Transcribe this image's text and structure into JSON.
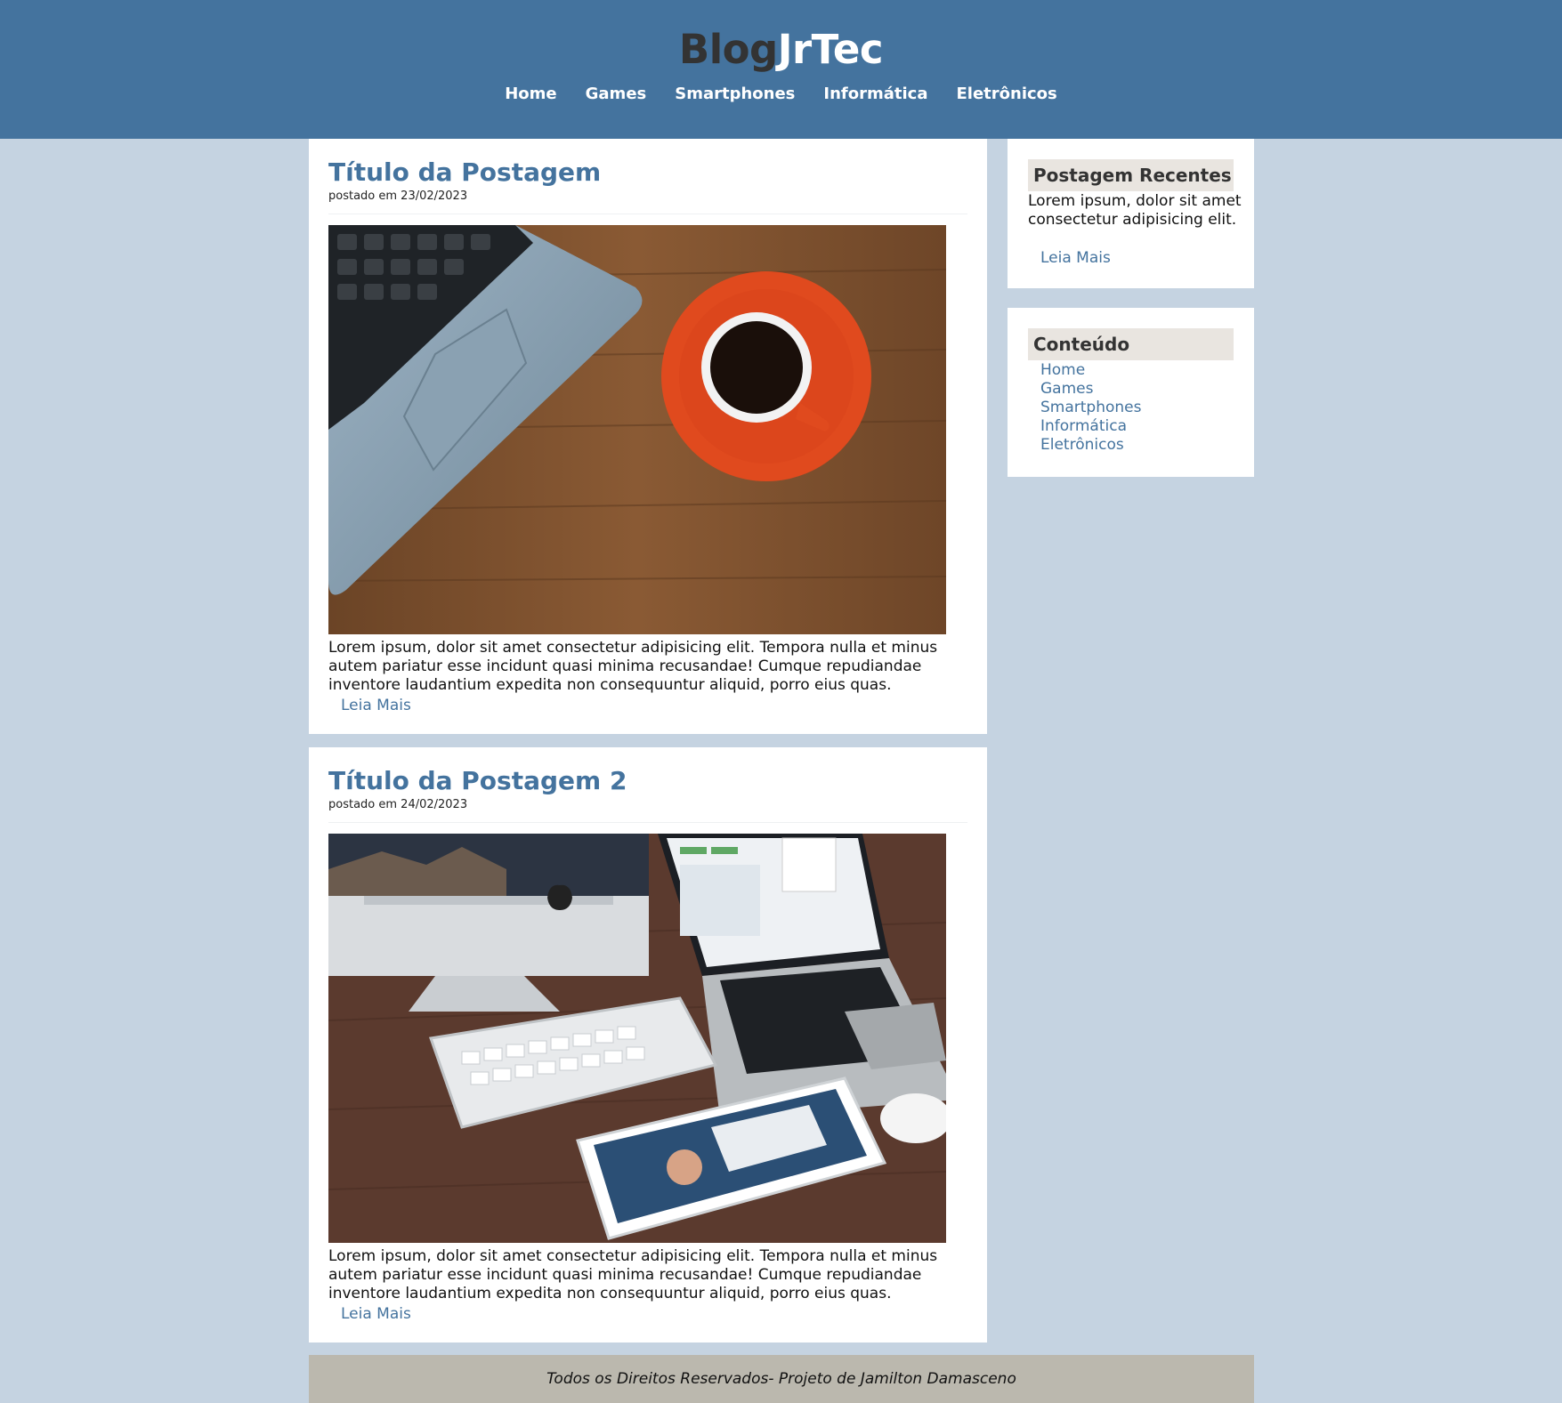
{
  "header": {
    "logo_part1": "Blog",
    "logo_part2": "JrTec",
    "nav": [
      "Home",
      "Games",
      "Smartphones",
      "Informática",
      "Eletrônicos"
    ]
  },
  "posts": [
    {
      "title": "Título da Postagem",
      "date": "postado em 23/02/2023",
      "body": "Lorem ipsum, dolor sit amet consectetur adipisicing elit. Tempora nulla et minus autem pariatur esse incidunt quasi minima recusandae! Cumque repudiandae inventore laudantium expedita non consequuntur aliquid, porro eius quas.",
      "read_more": "Leia Mais"
    },
    {
      "title": "Título da Postagem 2",
      "date": "postado em 24/02/2023",
      "body": "Lorem ipsum, dolor sit amet consectetur adipisicing elit. Tempora nulla et minus autem pariatur esse incidunt quasi minima recusandae! Cumque repudiandae inventore laudantium expedita non consequuntur aliquid, porro eius quas.",
      "read_more": "Leia Mais"
    }
  ],
  "sidebar": {
    "recent": {
      "title": "Postagem Recentes",
      "text": "Lorem ipsum, dolor sit amet consectetur adipisicing elit.",
      "link": "Leia Mais"
    },
    "content": {
      "title": "Conteúdo",
      "links": [
        "Home",
        "Games",
        "Smartphones",
        "Informática",
        "Eletrônicos"
      ]
    }
  },
  "footer": {
    "text": "Todos os Direitos Reservados- Projeto de Jamilton Damasceno"
  },
  "colors": {
    "header_bg": "#44739e",
    "page_bg": "#c5d3e1",
    "link": "#44739e",
    "sidebar_head_bg": "#e9e5e0",
    "footer_bg": "#bbb8ae"
  }
}
